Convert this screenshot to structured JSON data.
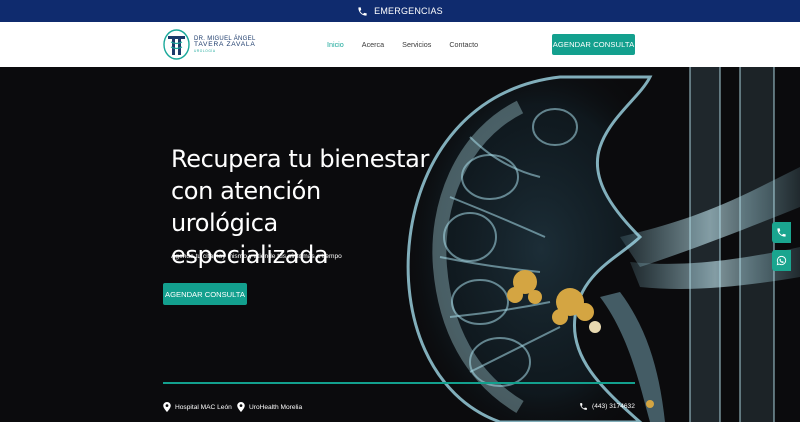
{
  "topbar": {
    "label": "EMERGENCIAS",
    "icon": "phone-icon"
  },
  "logo": {
    "line1": "DR. MIGUEL ÁNGEL",
    "line2": "TAVERA ZAVALA",
    "line3": "UROLOGÍA"
  },
  "nav": [
    {
      "label": "Inicio",
      "active": true
    },
    {
      "label": "Acerca",
      "active": false
    },
    {
      "label": "Servicios",
      "active": false
    },
    {
      "label": "Contacto",
      "active": false
    }
  ],
  "header_cta": "AGENDAR CONSULTA",
  "hero": {
    "headline_1": "Recupera tu bienestar",
    "headline_2": "con atención urológica",
    "headline_3": "especializada",
    "subline": "Agenda tu cita hoy mismo y atiende tus síntomas a tiempo",
    "cta": "AGENDAR CONSULTA"
  },
  "locations": [
    {
      "label": "Hospital MAC León",
      "icon": "location-pin-icon"
    },
    {
      "label": "UroHealth Morelia",
      "icon": "location-pin-icon"
    }
  ],
  "phone": {
    "label": "(443) 3174632",
    "icon": "phone-icon"
  },
  "floating": {
    "phone_icon": "phone-icon",
    "whatsapp_icon": "whatsapp-icon"
  },
  "colors": {
    "topbar": "#0f2b6e",
    "accent": "#13a08e",
    "hero_bg": "#0b0b0d"
  }
}
